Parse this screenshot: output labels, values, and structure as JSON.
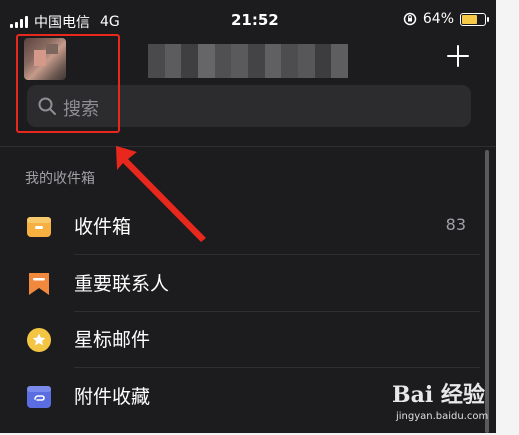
{
  "status_bar": {
    "carrier": "中国电信",
    "network": "4G",
    "time": "21:52",
    "battery": "64%",
    "battery_level": 0.64
  },
  "search": {
    "placeholder": "搜索"
  },
  "mailbox": {
    "section_title": "我的收件箱",
    "items": [
      {
        "label": "收件箱",
        "count": "83",
        "icon": "inbox-tray-icon",
        "color": "#f5b041"
      },
      {
        "label": "重要联系人",
        "count": "",
        "icon": "bookmark-icon",
        "color": "#f0883e"
      },
      {
        "label": "星标邮件",
        "count": "",
        "icon": "star-icon",
        "color": "#f4c542"
      },
      {
        "label": "附件收藏",
        "count": "",
        "icon": "paperclip-icon",
        "color": "#5b6ee1"
      }
    ]
  },
  "annotation": {
    "color": "#e8271d"
  },
  "watermark": {
    "brand": "Bai 经验",
    "url": "jingyan.baidu.com"
  },
  "colors": {
    "background": "#1c1c1e",
    "search_bg": "#2c2c2e"
  }
}
